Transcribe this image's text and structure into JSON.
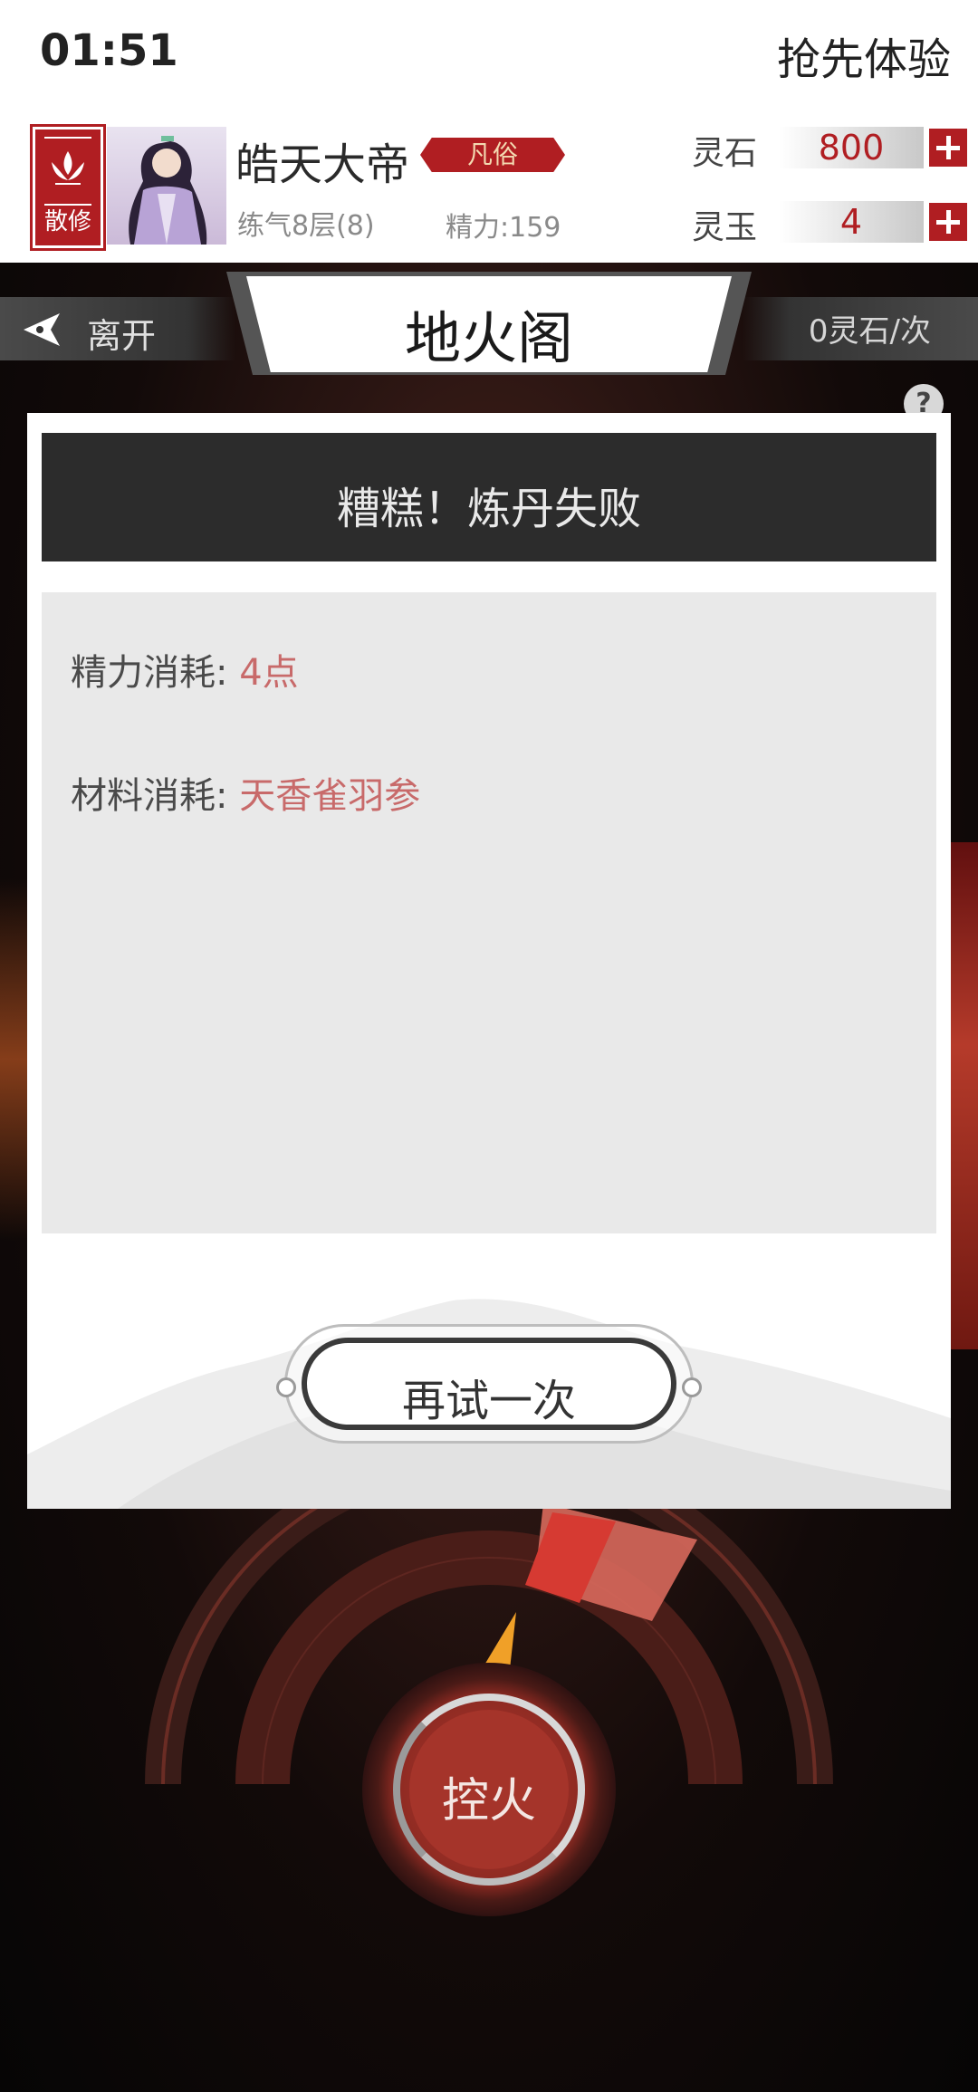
{
  "status_bar": {
    "time": "01:51",
    "early_access": "抢先体验"
  },
  "player": {
    "sect": "散修",
    "name": "皓天大帝",
    "rank": "凡俗",
    "cultivation": "练气8层(8)",
    "energy": "精力:159"
  },
  "currency": {
    "spirit_stone_label": "灵石",
    "spirit_stone_value": "800",
    "spirit_jade_label": "灵玉",
    "spirit_jade_value": "4"
  },
  "scene": {
    "leave_label": "离开",
    "title": "地火阁",
    "cost": "0灵石/次",
    "help": "?"
  },
  "dialog": {
    "title": "糟糕！炼丹失败",
    "energy_cost_label": "精力消耗:",
    "energy_cost_value": "4点",
    "material_cost_label": "材料消耗:",
    "material_cost_value": "天香雀羽参",
    "retry_label": "再试一次"
  },
  "controls": {
    "fire_label": "控火"
  },
  "colors": {
    "accent_red": "#b01e22",
    "value_red": "#c86a6a",
    "dark_panel": "#2c2c2c"
  }
}
